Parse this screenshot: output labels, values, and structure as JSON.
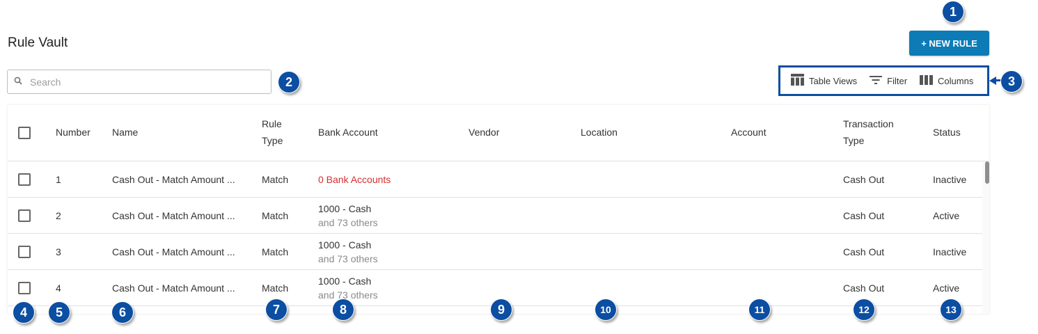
{
  "page": {
    "title": "Rule Vault"
  },
  "toolbar": {
    "new_rule_label": "+ NEW RULE",
    "table_views_label": "Table Views",
    "filter_label": "Filter",
    "columns_label": "Columns"
  },
  "search": {
    "placeholder": "Search",
    "value": ""
  },
  "table": {
    "headers": {
      "number": "Number",
      "name": "Name",
      "rule_type_1": "Rule",
      "rule_type_2": "Type",
      "bank_account": "Bank Account",
      "vendor": "Vendor",
      "location": "Location",
      "account": "Account",
      "transaction_type_1": "Transaction",
      "transaction_type_2": "Type",
      "status": "Status"
    },
    "rows": [
      {
        "number": "1",
        "name": "Cash Out - Match Amount ...",
        "rule_type": "Match",
        "bank_account": "0 Bank Accounts",
        "bank_account_sub": "",
        "vendor": "",
        "location": "",
        "account": "",
        "transaction_type": "Cash Out",
        "status": "Inactive"
      },
      {
        "number": "2",
        "name": "Cash Out - Match Amount ...",
        "rule_type": "Match",
        "bank_account": "1000 - Cash",
        "bank_account_sub": "and 73 others",
        "vendor": "",
        "location": "",
        "account": "",
        "transaction_type": "Cash Out",
        "status": "Active"
      },
      {
        "number": "3",
        "name": "Cash Out - Match Amount ...",
        "rule_type": "Match",
        "bank_account": "1000 - Cash",
        "bank_account_sub": "and 73 others",
        "vendor": "",
        "location": "",
        "account": "",
        "transaction_type": "Cash Out",
        "status": "Inactive"
      },
      {
        "number": "4",
        "name": "Cash Out - Match Amount ...",
        "rule_type": "Match",
        "bank_account": "1000 - Cash",
        "bank_account_sub": "and 73 others",
        "vendor": "",
        "location": "",
        "account": "",
        "transaction_type": "Cash Out",
        "status": "Active"
      }
    ]
  },
  "callouts": [
    "1",
    "2",
    "3",
    "4",
    "5",
    "6",
    "7",
    "8",
    "9",
    "10",
    "11",
    "12",
    "13"
  ],
  "colors": {
    "accent": "#0d7bb6",
    "callout": "#0b4ea2",
    "alert": "#d32f2f"
  }
}
